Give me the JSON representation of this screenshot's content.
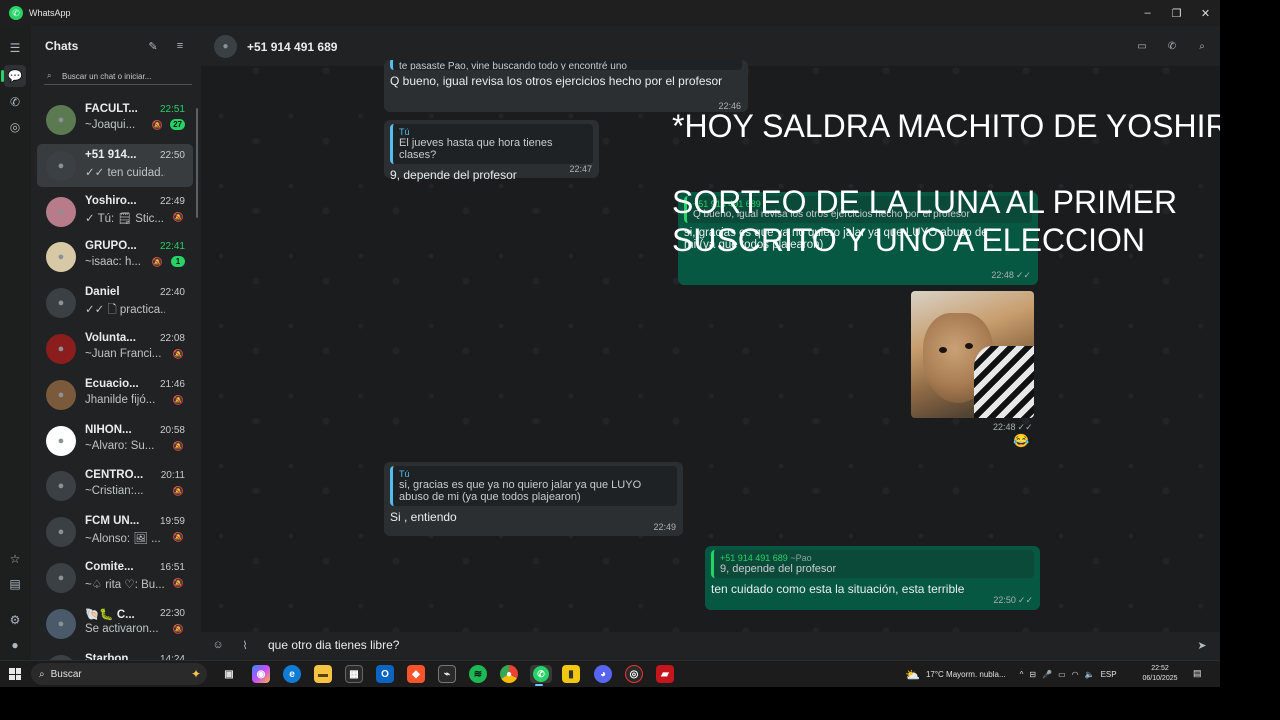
{
  "window": {
    "app_name": "WhatsApp",
    "minimize": "–",
    "maximize": "❐",
    "close": "✕"
  },
  "rail": {
    "icons": [
      "chats-icon",
      "calls-icon",
      "status-icon",
      "starred-icon",
      "archive-icon",
      "settings-icon",
      "profile-icon"
    ]
  },
  "chatlist": {
    "title": "Chats",
    "search_placeholder": "Buscar un chat o iniciar...",
    "items": [
      {
        "name": "FACULT...",
        "time": "22:51",
        "time_green": true,
        "preview": "~Joaqui...",
        "muted": true,
        "badge": "27"
      },
      {
        "name": "+51 914...",
        "time": "22:50",
        "preview": "✓✓ ten cuidad...",
        "selected": true
      },
      {
        "name": "Yoshiro...",
        "time": "22:49",
        "preview": "✓ Tú: 🗒 Stic...",
        "muted": true
      },
      {
        "name": "GRUPO...",
        "time": "22:41",
        "time_green": true,
        "preview": "~isaac: h...",
        "muted": true,
        "badge": "1"
      },
      {
        "name": "Daniel",
        "time": "22:40",
        "preview": "✓✓ 🗋 practica..."
      },
      {
        "name": "Volunta...",
        "time": "22:08",
        "preview": "~Juan Franci...",
        "muted": true
      },
      {
        "name": "Ecuacio...",
        "time": "21:46",
        "preview": "Jhanilde fijó...",
        "muted": true
      },
      {
        "name": "NIHON...",
        "time": "20:58",
        "preview": "~Alvaro: Su...",
        "muted": true
      },
      {
        "name": "CENTRO...",
        "time": "20:11",
        "preview": "~Cristian:...",
        "muted": true
      },
      {
        "name": "FCM UN...",
        "time": "19:59",
        "preview": "~Alonso: 🖼 ...",
        "muted": true
      },
      {
        "name": "Comite...",
        "time": "16:51",
        "preview": "~♤ rita ♡: Bu...",
        "muted": true
      },
      {
        "name": "🐚🐛 C...",
        "time": "22:30",
        "preview": "Se activaron...",
        "muted": true
      },
      {
        "name": "Starbon...",
        "time": "14:24",
        "preview": "",
        "muted": false
      }
    ]
  },
  "conversation": {
    "title": "+51 914 491 689",
    "messages": {
      "m1": {
        "quote_partial": "te pasaste Pao, vine buscando todo y encontré uno",
        "text": "Q bueno, igual revisa los otros ejercicios hecho por el profesor",
        "time": "22:46"
      },
      "m2": {
        "quote_author": "Tú",
        "quote": "El jueves hasta que hora tienes clases?",
        "text": "9, depende del profesor",
        "time": "22:47"
      },
      "m3": {
        "quote_author": "+51 914 491 689",
        "quote": "Q bueno, igual revisa los otros ejercicios hecho por el profesor",
        "text": "si, gracias es que ya no quiero jalar ya que LUYO abuso de mi (ya que todos plajearon)",
        "time": "22:48",
        "check": "✓✓"
      },
      "m4": {
        "time": "22:48",
        "check": "✓✓",
        "reaction": "😂"
      },
      "m5": {
        "quote_author": "Tú",
        "quote": "si, gracias es que ya no quiero jalar ya que LUYO abuso de mi (ya que todos plajearon)",
        "text": "Si , entiendo",
        "time": "22:49"
      },
      "m6": {
        "quote_author": "+51 914 491 689",
        "quote_suffix": "~Pao",
        "quote": "9, depende del profesor",
        "text": "ten cuidado como esta la situación, esta terrible",
        "time": "22:50",
        "check": "✓✓"
      }
    },
    "composer_text": "que otro dia tienes libre?"
  },
  "overlay": {
    "line1": "*HOY SALDRA MACHITO DE YOSHIRO*",
    "line2": "SORTEO DE LA LUNA AL  PRIMER",
    "line3": "SUSCRITO Y UNO A ELECCION"
  },
  "taskbar": {
    "search_label": "Buscar",
    "weather": "17°C  Mayorm. nubla...",
    "lang": "ESP",
    "time": "22:52",
    "date": "06/10/2025"
  }
}
